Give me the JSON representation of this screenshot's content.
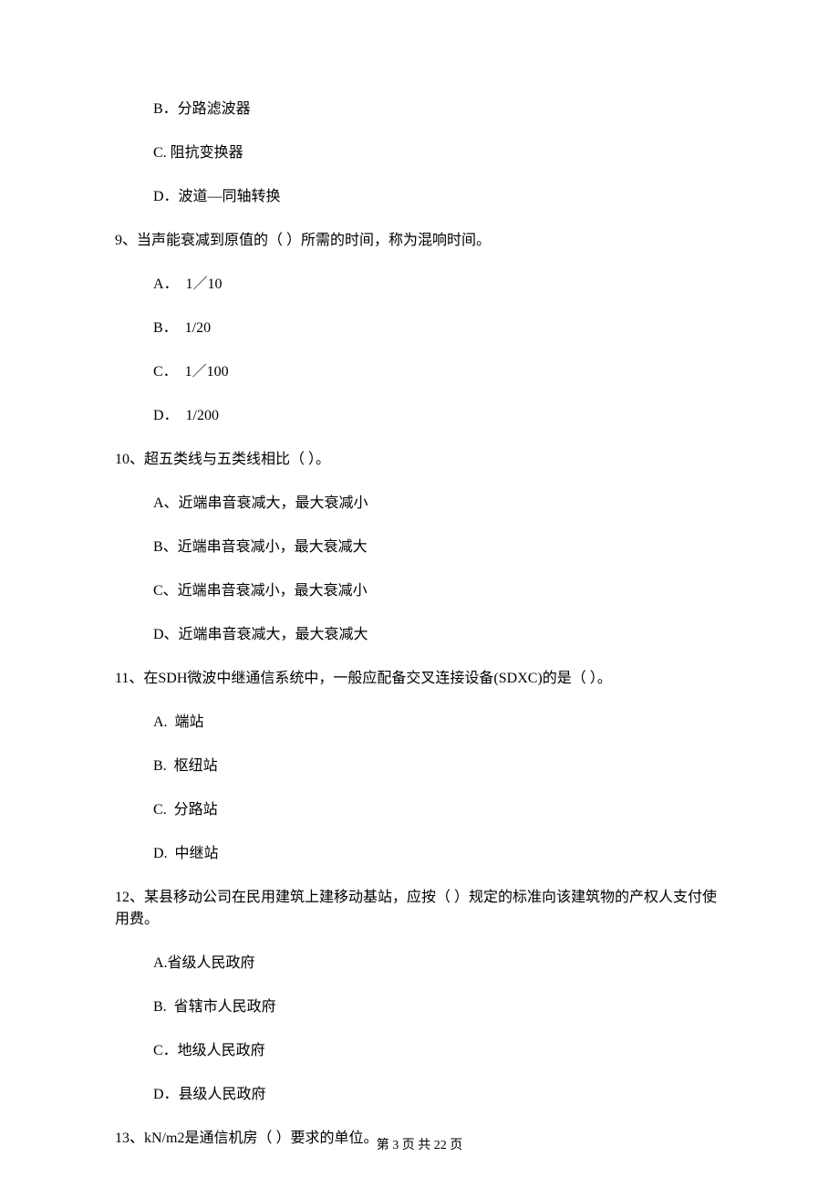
{
  "q8": {
    "optB": "B．分路滤波器",
    "optC": "C. 阻抗变换器",
    "optD": "D．波道—同轴转换"
  },
  "q9": {
    "text": "9、当声能衰减到原值的（    ）所需的时间，称为混响时间。",
    "optA": "A．  1／10",
    "optB": "B．  1/20",
    "optC": "C．  1／100",
    "optD": "D．  1/200"
  },
  "q10": {
    "text": "10、超五类线与五类线相比（    ）。",
    "optA": "A、近端串音衰减大，最大衰减小",
    "optB": "B、近端串音衰减小，最大衰减大",
    "optC": "C、近端串音衰减小，最大衰减小",
    "optD": "D、近端串音衰减大，最大衰减大"
  },
  "q11": {
    "text": "11、在SDH微波中继通信系统中，一般应配备交叉连接设备(SDXC)的是（    ）。",
    "optA": "A.  端站",
    "optB": "B.  枢纽站",
    "optC": "C.  分路站",
    "optD": "D.  中继站"
  },
  "q12": {
    "text": "12、某县移动公司在民用建筑上建移动基站，应按（    ）规定的标准向该建筑物的产权人支付使用费。",
    "optA": "A.省级人民政府",
    "optB": "B.  省辖市人民政府",
    "optC": "C．地级人民政府",
    "optD": "D．县级人民政府"
  },
  "q13": {
    "text": "13、kN/m2是通信机房（    ）要求的单位。"
  },
  "footer": "第 3 页 共 22 页"
}
